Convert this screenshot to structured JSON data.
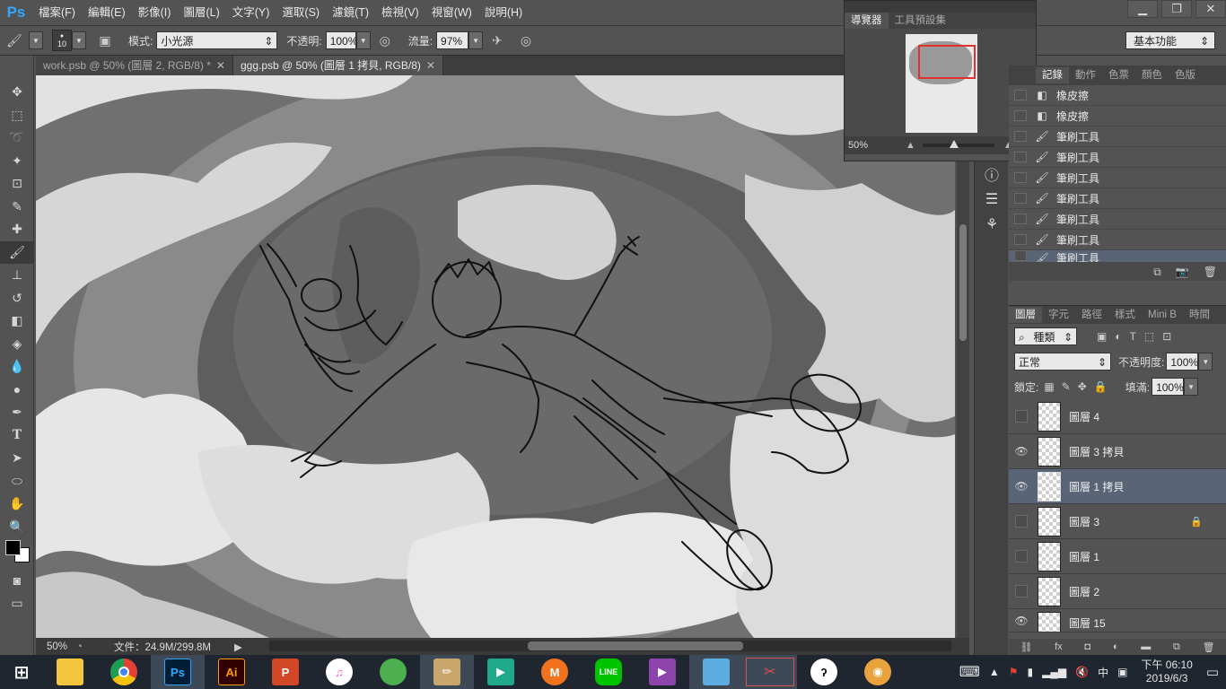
{
  "app": {
    "logo": "Ps"
  },
  "menu": [
    "檔案(F)",
    "編輯(E)",
    "影像(I)",
    "圖層(L)",
    "文字(Y)",
    "選取(S)",
    "濾鏡(T)",
    "檢視(V)",
    "視窗(W)",
    "說明(H)"
  ],
  "window_controls": [
    "minimize-icon",
    "restore-icon",
    "close-icon"
  ],
  "options": {
    "brush_size": "10",
    "mode_label": "模式:",
    "mode_value": "小光源",
    "opacity_label": "不透明:",
    "opacity_value": "100%",
    "flow_label": "流量:",
    "flow_value": "97%"
  },
  "workspace": "基本功能",
  "tools": [
    "move-icon",
    "marquee-icon",
    "lasso-icon",
    "magic-wand-icon",
    "crop-icon",
    "eyedropper-icon",
    "healing-icon",
    "brush-icon",
    "clone-stamp-icon",
    "history-brush-icon",
    "eraser-icon",
    "paint-bucket-icon",
    "blur-icon",
    "dodge-icon",
    "pen-icon",
    "type-icon",
    "path-select-icon",
    "ellipse-icon",
    "hand-icon",
    "zoom-icon"
  ],
  "document_tabs": [
    {
      "label": "work.psb @ 50% (圖層 2, RGB/8) *"
    },
    {
      "label": "ggg.psb @ 50% (圖層 1 拷貝, RGB/8)"
    }
  ],
  "status": {
    "zoom": "50%",
    "file_info": "文件：24.9M/299.8M"
  },
  "navigator": {
    "tabs": [
      "導覽器",
      "工具預設集"
    ],
    "zoom": "50%"
  },
  "history": {
    "tabs": [
      "記錄",
      "動作",
      "色票",
      "顏色",
      "色版"
    ],
    "items": [
      {
        "label": "橡皮擦",
        "icon": "eraser-icon"
      },
      {
        "label": "橡皮擦",
        "icon": "eraser-icon"
      },
      {
        "label": "筆刷工具",
        "icon": "brush-icon"
      },
      {
        "label": "筆刷工具",
        "icon": "brush-icon"
      },
      {
        "label": "筆刷工具",
        "icon": "brush-icon"
      },
      {
        "label": "筆刷工具",
        "icon": "brush-icon"
      },
      {
        "label": "筆刷工具",
        "icon": "brush-icon"
      },
      {
        "label": "筆刷工具",
        "icon": "brush-icon"
      },
      {
        "label": "筆刷工具",
        "icon": "brush-icon"
      }
    ]
  },
  "layers": {
    "tabs": [
      "圖層",
      "字元",
      "路徑",
      "樣式",
      "Mini B",
      "時間"
    ],
    "filter_value": "種類",
    "blend_mode": "正常",
    "opacity_label": "不透明度:",
    "opacity_value": "100%",
    "lock_label": "鎖定:",
    "fill_label": "填滿:",
    "fill_value": "100%",
    "items": [
      {
        "name": "圖層 4",
        "visible": false,
        "locked": false,
        "selected": false
      },
      {
        "name": "圖層 3 拷貝",
        "visible": true,
        "locked": false,
        "selected": false
      },
      {
        "name": "圖層 1 拷貝",
        "visible": true,
        "locked": false,
        "selected": true
      },
      {
        "name": "圖層 3",
        "visible": false,
        "locked": true,
        "selected": false
      },
      {
        "name": "圖層 1",
        "visible": false,
        "locked": false,
        "selected": false
      },
      {
        "name": "圖層 2",
        "visible": false,
        "locked": false,
        "selected": false
      },
      {
        "name": "圖層 15",
        "visible": true,
        "locked": false,
        "selected": false
      }
    ]
  },
  "taskbar": {
    "apps": [
      {
        "icon": "start-icon",
        "label": "",
        "color": "#ffffff"
      },
      {
        "icon": "file-explorer-icon",
        "label": "",
        "color": "#f3c640"
      },
      {
        "icon": "chrome-icon",
        "label": "",
        "color": "#e34133"
      },
      {
        "icon": "photoshop-icon",
        "label": "Ps",
        "color": "#31a8ff"
      },
      {
        "icon": "illustrator-icon",
        "label": "Ai",
        "color": "#ff9a00"
      },
      {
        "icon": "powerpoint-icon",
        "label": "P",
        "color": "#d24726"
      },
      {
        "icon": "itunes-icon",
        "label": "♫",
        "color": "#e85fd0"
      },
      {
        "icon": "painter-icon",
        "label": "",
        "color": "#4caf50"
      },
      {
        "icon": "pencil-app-icon",
        "label": "",
        "color": "#c9a66b"
      },
      {
        "icon": "media-player-icon",
        "label": "▶",
        "color": "#1fa88a"
      },
      {
        "icon": "mega-icon",
        "label": "M",
        "color": "#f0721c"
      },
      {
        "icon": "line-icon",
        "label": "LINE",
        "color": "#00c300"
      },
      {
        "icon": "visual-studio-icon",
        "label": "",
        "color": "#8e44ad"
      },
      {
        "icon": "notes-app-icon",
        "label": "",
        "color": "#5dade2"
      },
      {
        "icon": "snipping-tool-icon",
        "label": "",
        "color": "#d9534f"
      },
      {
        "icon": "clip-studio-icon",
        "label": "",
        "color": "#ffffff"
      },
      {
        "icon": "eye-app-icon",
        "label": "",
        "color": "#e8a33d"
      }
    ],
    "clock_time": "下午 06:10",
    "clock_date": "2019/6/3",
    "ime_label": "中"
  }
}
